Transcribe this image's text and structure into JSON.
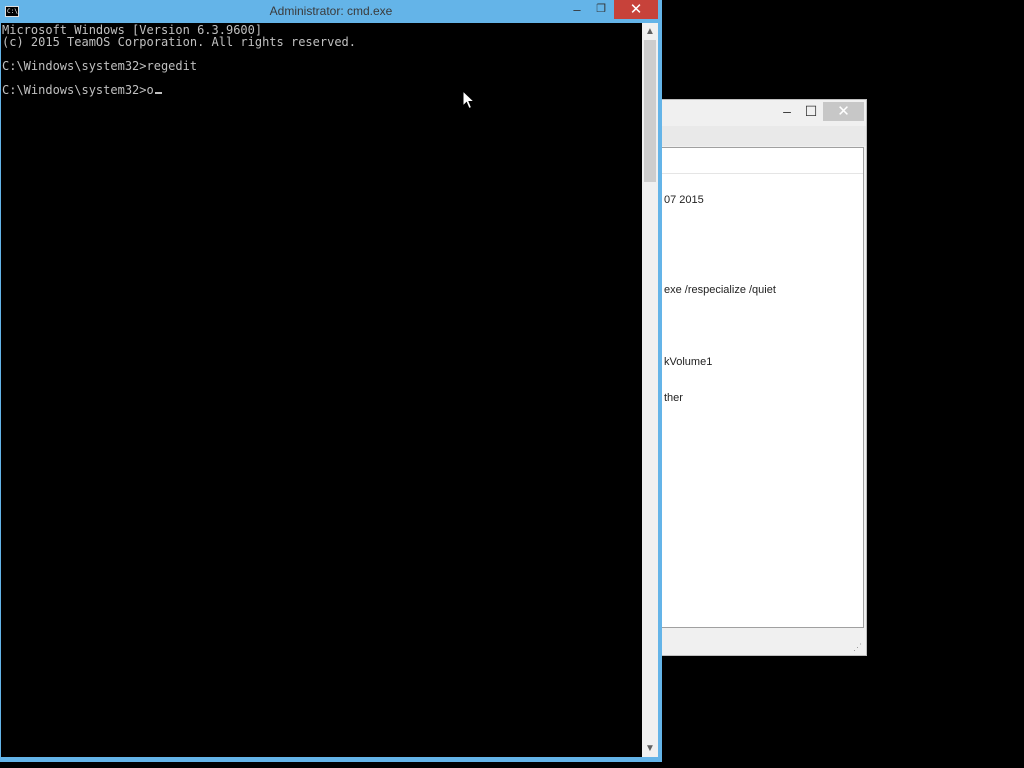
{
  "cmd_window": {
    "title": "Administrator: cmd.exe",
    "controls": {
      "minimize": "–",
      "maximize": "❐",
      "close": "✕"
    },
    "lines": [
      "Microsoft Windows [Version 6.3.9600]",
      "(c) 2015 TeamOS Corporation. All rights reserved.",
      "",
      "C:\\Windows\\system32>regedit",
      "",
      "C:\\Windows\\system32>o"
    ],
    "scroll_arrows": {
      "up": "▲",
      "down": "▼"
    }
  },
  "background_window": {
    "controls": {
      "minimize": "–",
      "maximize": "☐",
      "close": "✕"
    },
    "visible_text": [
      "07 2015",
      "exe /respecialize /quiet",
      "kVolume1",
      "ther"
    ]
  },
  "icons": [
    "cmd-app-icon",
    "mouse-pointer-icon",
    "resize-grip-icon"
  ],
  "colors": {
    "titlebar": "#64b4e8",
    "close_active": "#c7423a",
    "console_bg": "#000000",
    "console_text": "#c0c0c0"
  }
}
